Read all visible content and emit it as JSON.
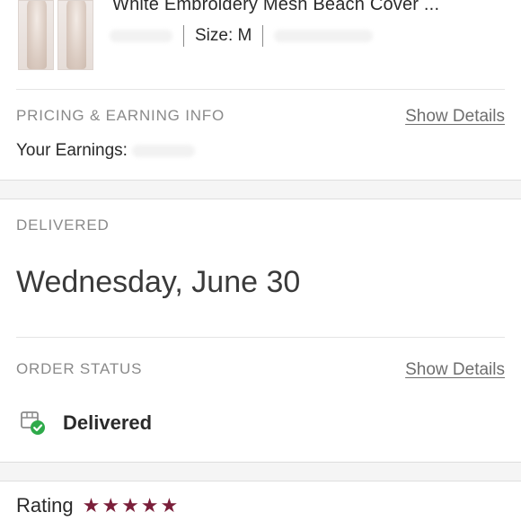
{
  "item": {
    "title": "White Embroidery Mesh Beach Cover ...",
    "size_label": "Size: M"
  },
  "pricing": {
    "section_label": "PRICING & EARNING INFO",
    "show_details": "Show Details",
    "earnings_label": "Your Earnings: "
  },
  "delivery": {
    "section_label": "DELIVERED",
    "date": "Wednesday, June 30"
  },
  "order_status": {
    "section_label": "ORDER STATUS",
    "show_details": "Show Details",
    "status": "Delivered",
    "status_color": "#2eaa4a"
  },
  "rating": {
    "label": "Rating",
    "stars": 5,
    "star_color": "#7a1f3a"
  }
}
